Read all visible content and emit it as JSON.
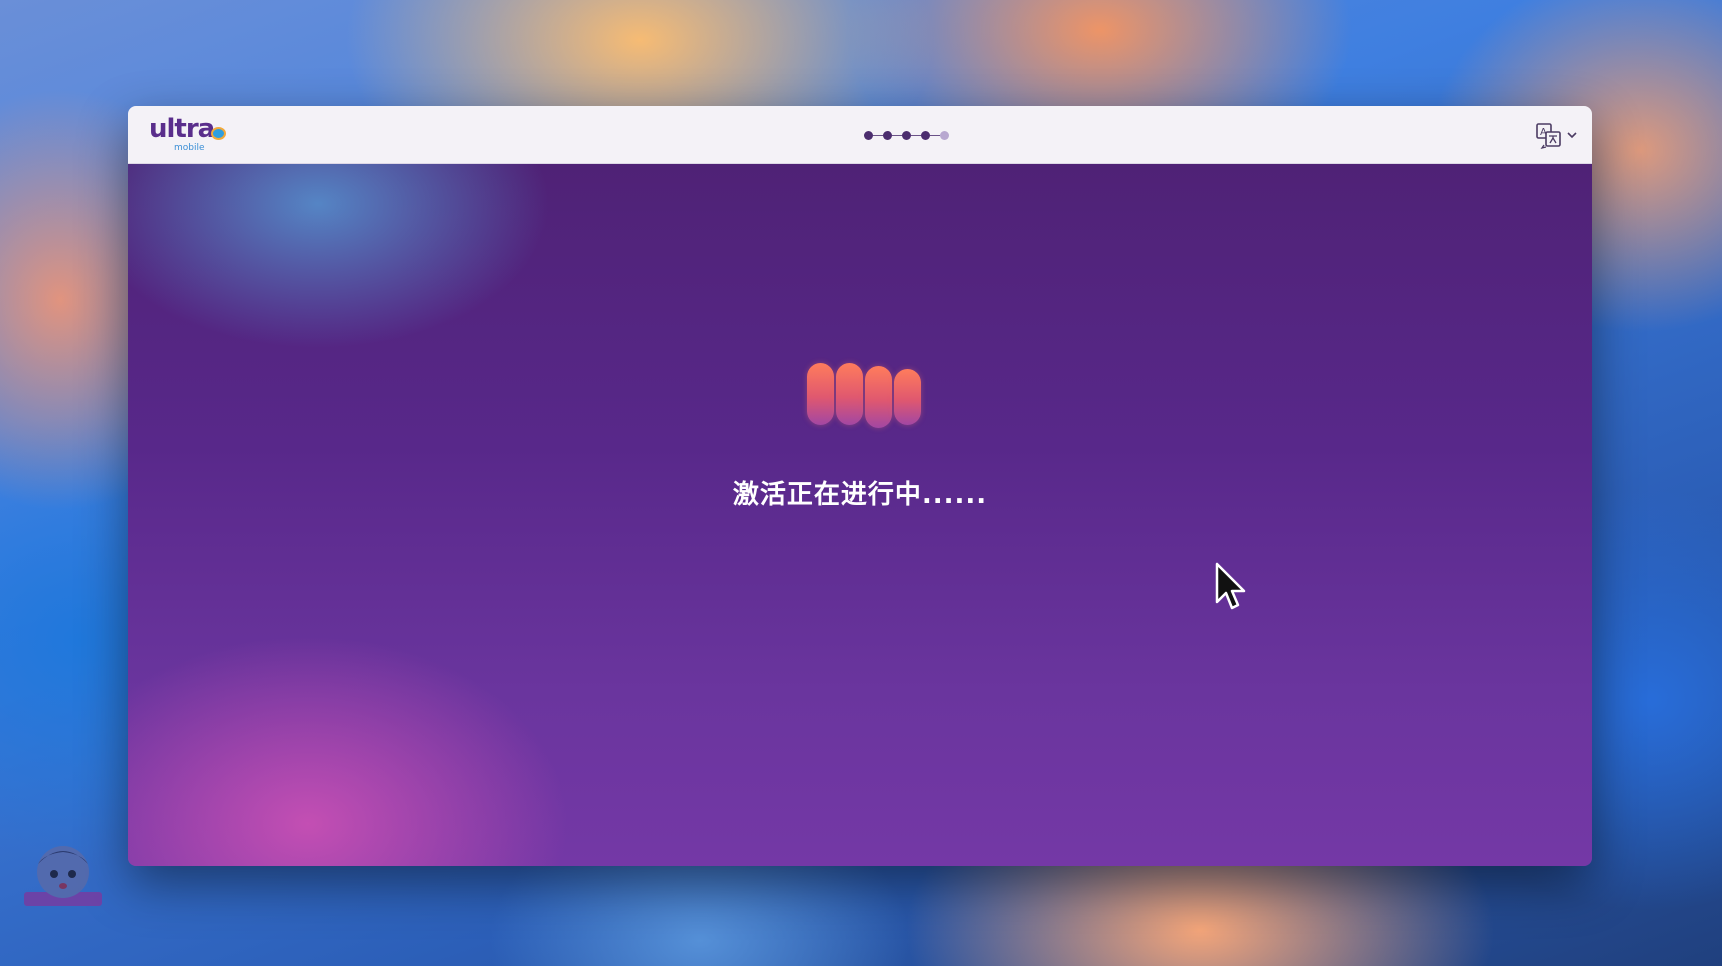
{
  "app": {
    "logo_word": "ultra",
    "logo_sub": "mobile",
    "brand_color": "#5a2e8c",
    "accent_color": "#3c8fd6"
  },
  "progress_steps": {
    "total": 5,
    "completed": 4
  },
  "header": {
    "language_icon": "translate-icon",
    "language_caret": "chevron-down-icon"
  },
  "main": {
    "loader_icon": "loading-bars-icon",
    "status_text": "激活正在进行中......"
  }
}
